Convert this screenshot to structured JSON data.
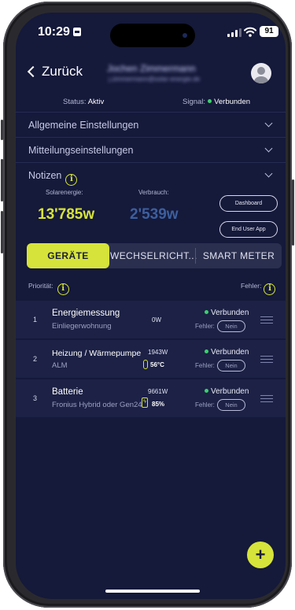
{
  "status_bar": {
    "time": "10:29",
    "battery": "91"
  },
  "nav": {
    "back_label": "Zurück",
    "user_name": "Jochen Zimmermann",
    "user_email": "j.zimmermann@solar-energie.de"
  },
  "status": {
    "status_label": "Status:",
    "status_value": "Aktiv",
    "signal_label": "Signal:",
    "signal_value": "Verbunden"
  },
  "sections": [
    {
      "label": "Allgemeine Einstellungen"
    },
    {
      "label": "Mitteilungseinstellungen"
    },
    {
      "label": "Notizen"
    }
  ],
  "energy": {
    "solar_label": "Solarenergie:",
    "solar_value": "13'785w",
    "consumption_label": "Verbrauch:",
    "consumption_value": "2'539w",
    "dashboard_button": "Dashboard",
    "enduser_button": "End User App"
  },
  "tabs": [
    {
      "label": "GERÄTE",
      "active": true
    },
    {
      "label": "WECHSELRICHT...",
      "active": false
    },
    {
      "label": "SMART METER",
      "active": false
    }
  ],
  "list_header": {
    "priority_label": "Priorität:",
    "error_label": "Fehler:"
  },
  "devices": [
    {
      "num": "1",
      "name": "Energiemessung",
      "sub": "Einliegerwohnung",
      "power": "0W",
      "extra": "",
      "conn": "Verbunden",
      "err_label": "Fehler:",
      "err_value": "Nein"
    },
    {
      "num": "2",
      "name": "Heizung / Wärmepumpe",
      "sub": "ALM",
      "power": "1943W",
      "extra": "56°C",
      "conn": "Verbunden",
      "err_label": "Fehler:",
      "err_value": "Nein"
    },
    {
      "num": "3",
      "name": "Batterie",
      "sub": "Fronius Hybrid oder Gen24",
      "power": "9661W",
      "extra": "85%",
      "conn": "Verbunden",
      "err_label": "Fehler:",
      "err_value": "Nein"
    }
  ],
  "fab_label": "+",
  "colors": {
    "accent": "#d6e33a",
    "background": "#15193a",
    "row": "#1c2145",
    "solar": "#d6e33a",
    "consumption": "#3c5f9e",
    "connected": "#3bd16f"
  }
}
